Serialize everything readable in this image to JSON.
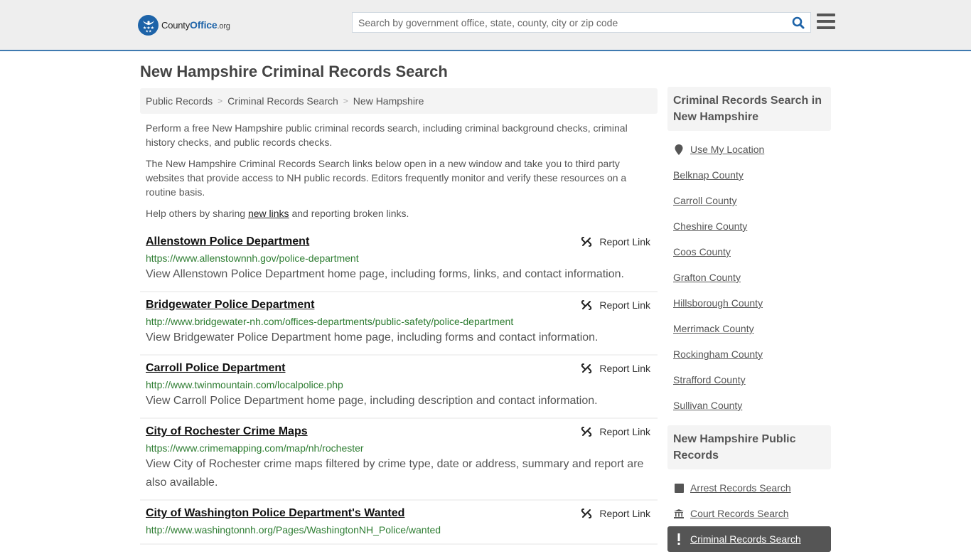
{
  "header": {
    "logo": {
      "part1": "County",
      "part2": "Office",
      "part3": ".org"
    },
    "search_placeholder": "Search by government office, state, county, city or zip code",
    "search_value": ""
  },
  "page_title": "New Hampshire Criminal Records Search",
  "breadcrumb": [
    "Public Records",
    "Criminal Records Search",
    "New Hampshire"
  ],
  "intro": {
    "p1": "Perform a free New Hampshire public criminal records search, including criminal background checks, criminal history checks, and public records checks.",
    "p2": "The New Hampshire Criminal Records Search links below open in a new window and take you to third party websites that provide access to NH public records. Editors frequently monitor and verify these resources on a routine basis.",
    "p3_before": "Help others by sharing ",
    "p3_link": "new links",
    "p3_after": " and reporting broken links."
  },
  "report_label": "Report Link",
  "results": [
    {
      "title": "Allenstown Police Department",
      "url": "https://www.allenstownnh.gov/police-department",
      "desc": "View Allenstown Police Department home page, including forms, links, and contact information."
    },
    {
      "title": "Bridgewater Police Department",
      "url": "http://www.bridgewater-nh.com/offices-departments/public-safety/police-department",
      "desc": "View Bridgewater Police Department home page, including forms and contact information."
    },
    {
      "title": "Carroll Police Department",
      "url": "http://www.twinmountain.com/localpolice.php",
      "desc": "View Carroll Police Department home page, including description and contact information."
    },
    {
      "title": "City of Rochester Crime Maps",
      "url": "https://www.crimemapping.com/map/nh/rochester",
      "desc": "View City of Rochester crime maps filtered by crime type, date or address, summary and report are also available."
    },
    {
      "title": "City of Washington Police Department's Wanted",
      "url": "http://www.washingtonnh.org/Pages/WashingtonNH_Police/wanted",
      "desc": ""
    }
  ],
  "sidebar": {
    "section1_title": "Criminal Records Search in New Hampshire",
    "use_location": "Use My Location",
    "counties": [
      "Belknap County",
      "Carroll County",
      "Cheshire County",
      "Coos County",
      "Grafton County",
      "Hillsborough County",
      "Merrimack County",
      "Rockingham County",
      "Strafford County",
      "Sullivan County"
    ],
    "section2_title": "New Hampshire Public Records",
    "public_records": [
      {
        "label": "Arrest Records Search",
        "icon": "square-icon"
      },
      {
        "label": "Court Records Search",
        "icon": "courthouse-icon"
      },
      {
        "label": "Criminal Records Search",
        "icon": "exclamation-icon",
        "active": true
      }
    ]
  },
  "colors": {
    "brand_blue": "#1d63a8",
    "header_border": "#3f7ab0",
    "url_green": "#2e7d32",
    "active_bg": "#555555"
  }
}
